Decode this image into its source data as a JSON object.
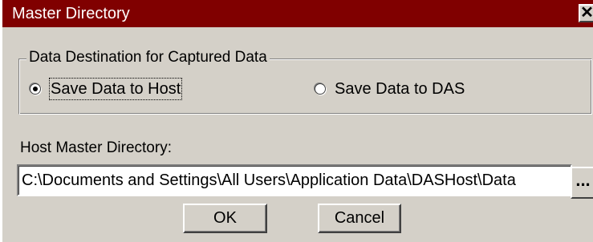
{
  "window": {
    "title": "Master Directory",
    "close_glyph": "✕",
    "titlebar_color": "#800000",
    "face_color": "#d4d0c8"
  },
  "destination_group": {
    "title": "Data Destination for Captured Data",
    "options": [
      {
        "label": "Save Data to Host",
        "selected": true
      },
      {
        "label": "Save Data to DAS",
        "selected": false
      }
    ]
  },
  "host_directory": {
    "label": "Host Master Directory:",
    "value": "C:\\Documents and Settings\\All Users\\Application Data\\DASHost\\Data",
    "browse_label": "..."
  },
  "buttons": {
    "ok": "OK",
    "cancel": "Cancel"
  }
}
